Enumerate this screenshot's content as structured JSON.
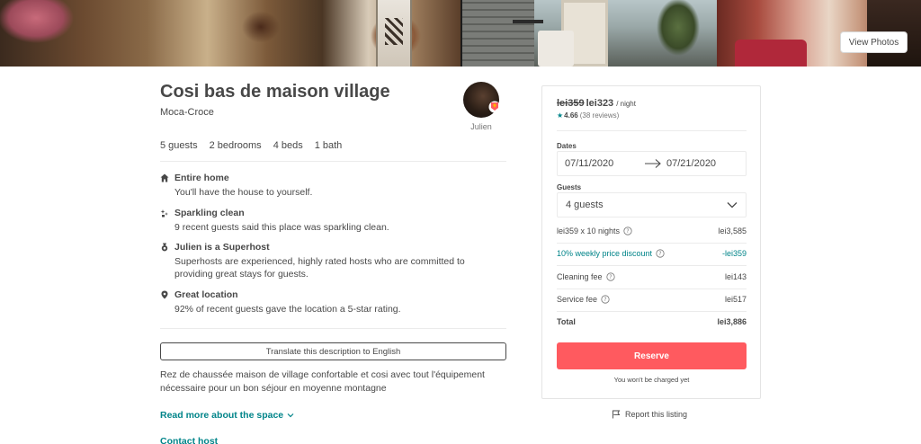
{
  "photos": {
    "view_photos_label": "View Photos"
  },
  "listing": {
    "title": "Cosi bas de maison village",
    "location": "Moca-Croce",
    "host_name": "Julien",
    "specs": [
      "5 guests",
      "2 bedrooms",
      "4 beds",
      "1 bath"
    ],
    "highlights": [
      {
        "icon": "home-icon",
        "title": "Entire home",
        "desc": "You'll have the house to yourself."
      },
      {
        "icon": "sparkle-icon",
        "title": "Sparkling clean",
        "desc": "9 recent guests said this place was sparkling clean."
      },
      {
        "icon": "medal-icon",
        "title": "Julien is a Superhost",
        "desc": "Superhosts are experienced, highly rated hosts who are committed to providing great stays for guests."
      },
      {
        "icon": "location-pin-icon",
        "title": "Great location",
        "desc": "92% of recent guests gave the location a 5-star rating."
      }
    ],
    "translate_label": "Translate this description to English",
    "description": "Rez de chaussée maison de village confortable et cosi avec tout l'équipement nécessaire pour un bon séjour en moyenne montagne",
    "read_more_label": "Read more about the space",
    "contact_host_label": "Contact host"
  },
  "booking": {
    "old_price": "lei359",
    "new_price": "lei323",
    "per_night": "/ night",
    "rating_score": "4.66",
    "rating_reviews": "(38 reviews)",
    "dates_label": "Dates",
    "check_in": "07/11/2020",
    "check_out": "07/21/2020",
    "guests_label": "Guests",
    "guests_value": "4 guests",
    "line_items": [
      {
        "label": "lei359 x 10 nights",
        "value": "lei3,585"
      },
      {
        "label": "10% weekly price discount",
        "value": "-lei359"
      },
      {
        "label": "Cleaning fee",
        "value": "lei143"
      },
      {
        "label": "Service fee",
        "value": "lei517"
      }
    ],
    "total_label": "Total",
    "total_value": "lei3,886",
    "reserve_label": "Reserve",
    "no_charge_note": "You won't be charged yet",
    "report_label": "Report this listing"
  },
  "colors": {
    "brand": "#ff5a5f",
    "accent": "#008489",
    "text": "#484848"
  }
}
